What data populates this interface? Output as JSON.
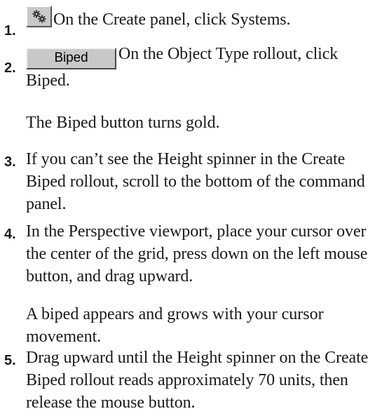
{
  "steps": [
    {
      "number": "1.",
      "icon": "systems-gear-icon",
      "text": "On the Create panel, click Systems."
    },
    {
      "number": "2.",
      "button_label": "Biped",
      "text": "On the Object Type rollout, click Biped.",
      "result": "The Biped button turns gold."
    },
    {
      "number": "3.",
      "text": "If you can’t see the Height spinner in the Create Biped rollout, scroll to the bottom of the command panel."
    },
    {
      "number": "4.",
      "text": "In the Perspective viewport, place your cursor over the center of the grid, press down on the left mouse button, and drag upward.",
      "result": "A biped appears and grows with your cursor movement."
    },
    {
      "number": "5.",
      "text": "Drag upward until the Height spinner on the Create Biped rollout reads approximately 70 units, then release the mouse button."
    }
  ]
}
